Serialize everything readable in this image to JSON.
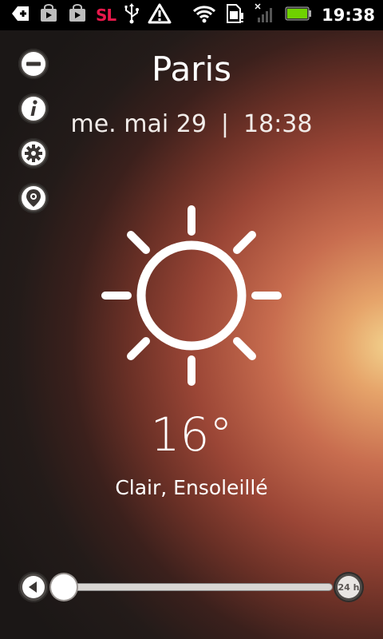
{
  "status_bar": {
    "carrier_badge": "SL",
    "time": "19:38",
    "icons": [
      "add-icon",
      "shopping-bag-icon",
      "play-store-icon",
      "usb-icon",
      "warning-icon",
      "wifi-icon",
      "sim-data-icon",
      "no-signal-icon",
      "battery-icon"
    ]
  },
  "sidebar": {
    "buttons": [
      {
        "name": "remove-location",
        "icon": "minus-icon"
      },
      {
        "name": "info",
        "icon": "info-icon"
      },
      {
        "name": "settings",
        "icon": "gear-icon"
      },
      {
        "name": "locate",
        "icon": "location-icon"
      }
    ]
  },
  "weather": {
    "city": "Paris",
    "date": "me. mai 29",
    "separator": "|",
    "time": "18:38",
    "icon": "sun-icon",
    "temperature": "16°",
    "condition": "Clair, Ensoleillé"
  },
  "timeline": {
    "end_label": "24 h",
    "progress": 0.0
  },
  "colors": {
    "carrier_badge": "#e8184b",
    "glow_center": "#f2d28d",
    "background": "#1b1716"
  }
}
